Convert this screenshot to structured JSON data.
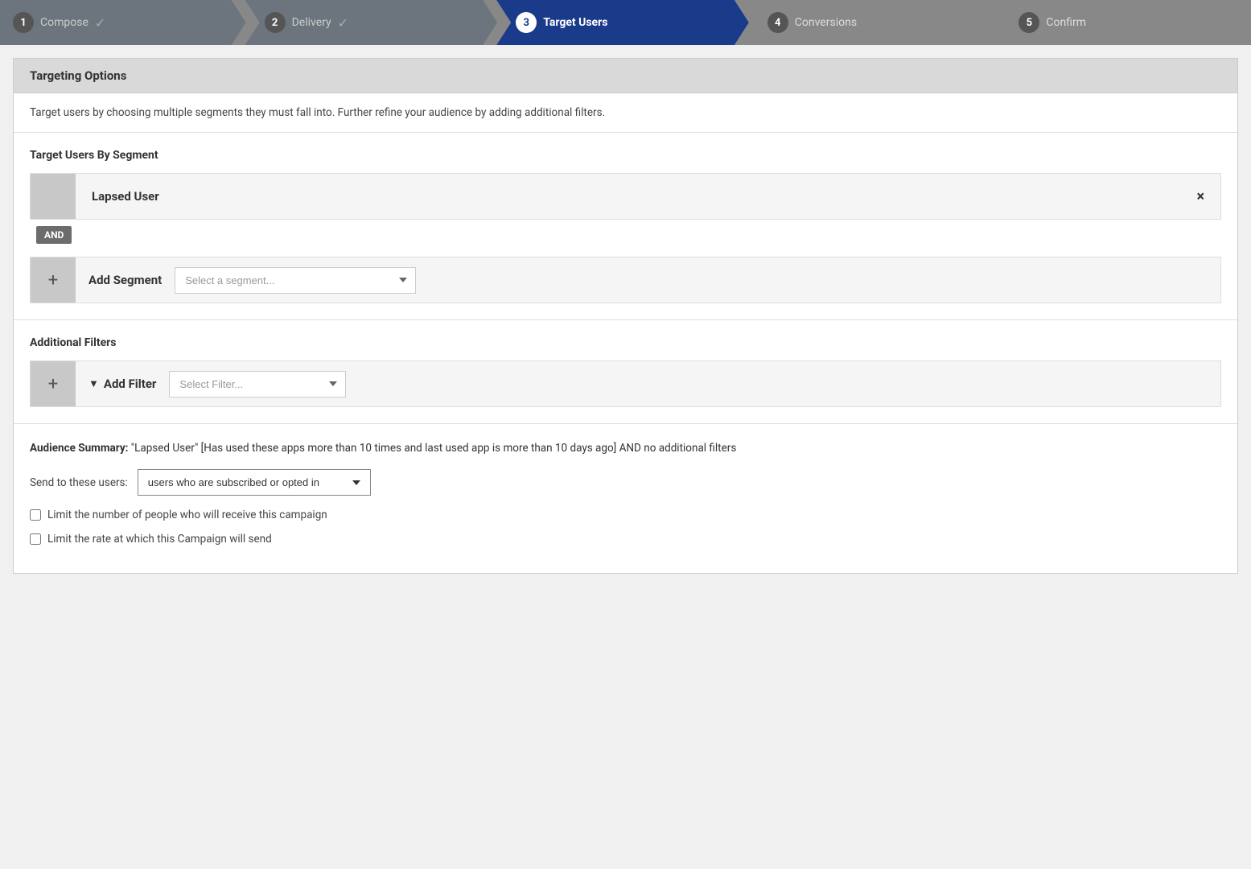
{
  "wizard": {
    "steps": [
      {
        "id": "compose",
        "number": "1",
        "label": "Compose",
        "state": "completed",
        "check": true
      },
      {
        "id": "delivery",
        "number": "2",
        "label": "Delivery",
        "state": "completed",
        "check": true
      },
      {
        "id": "target-users",
        "number": "3",
        "label": "Target Users",
        "state": "active",
        "check": false
      },
      {
        "id": "conversions",
        "number": "4",
        "label": "Conversions",
        "state": "inactive",
        "check": false
      },
      {
        "id": "confirm",
        "number": "5",
        "label": "Confirm",
        "state": "inactive",
        "check": false
      }
    ]
  },
  "targeting": {
    "section_title": "Targeting Options",
    "description": "Target users by choosing multiple segments they must fall into. Further refine your audience by adding additional filters.",
    "segment_section_title": "Target Users By Segment",
    "segment_name": "Lapsed User",
    "and_label": "AND",
    "add_segment_label": "Add Segment",
    "segment_placeholder": "Select a segment...",
    "filters_section_title": "Additional Filters",
    "add_filter_label": "Add Filter",
    "filter_placeholder": "Select Filter...",
    "audience_section": {
      "summary_prefix": "Audience Summary:",
      "summary_text": " \"Lapsed User\" [Has used these apps more than 10 times and last used app is more than 10 days ago] AND no additional filters",
      "send_to_label": "Send to these users:",
      "send_to_value": "users who are subscribed or opted in",
      "limit_number_label": "Limit the number of people who will receive this campaign",
      "limit_rate_label": "Limit the rate at which this Campaign will send"
    }
  }
}
